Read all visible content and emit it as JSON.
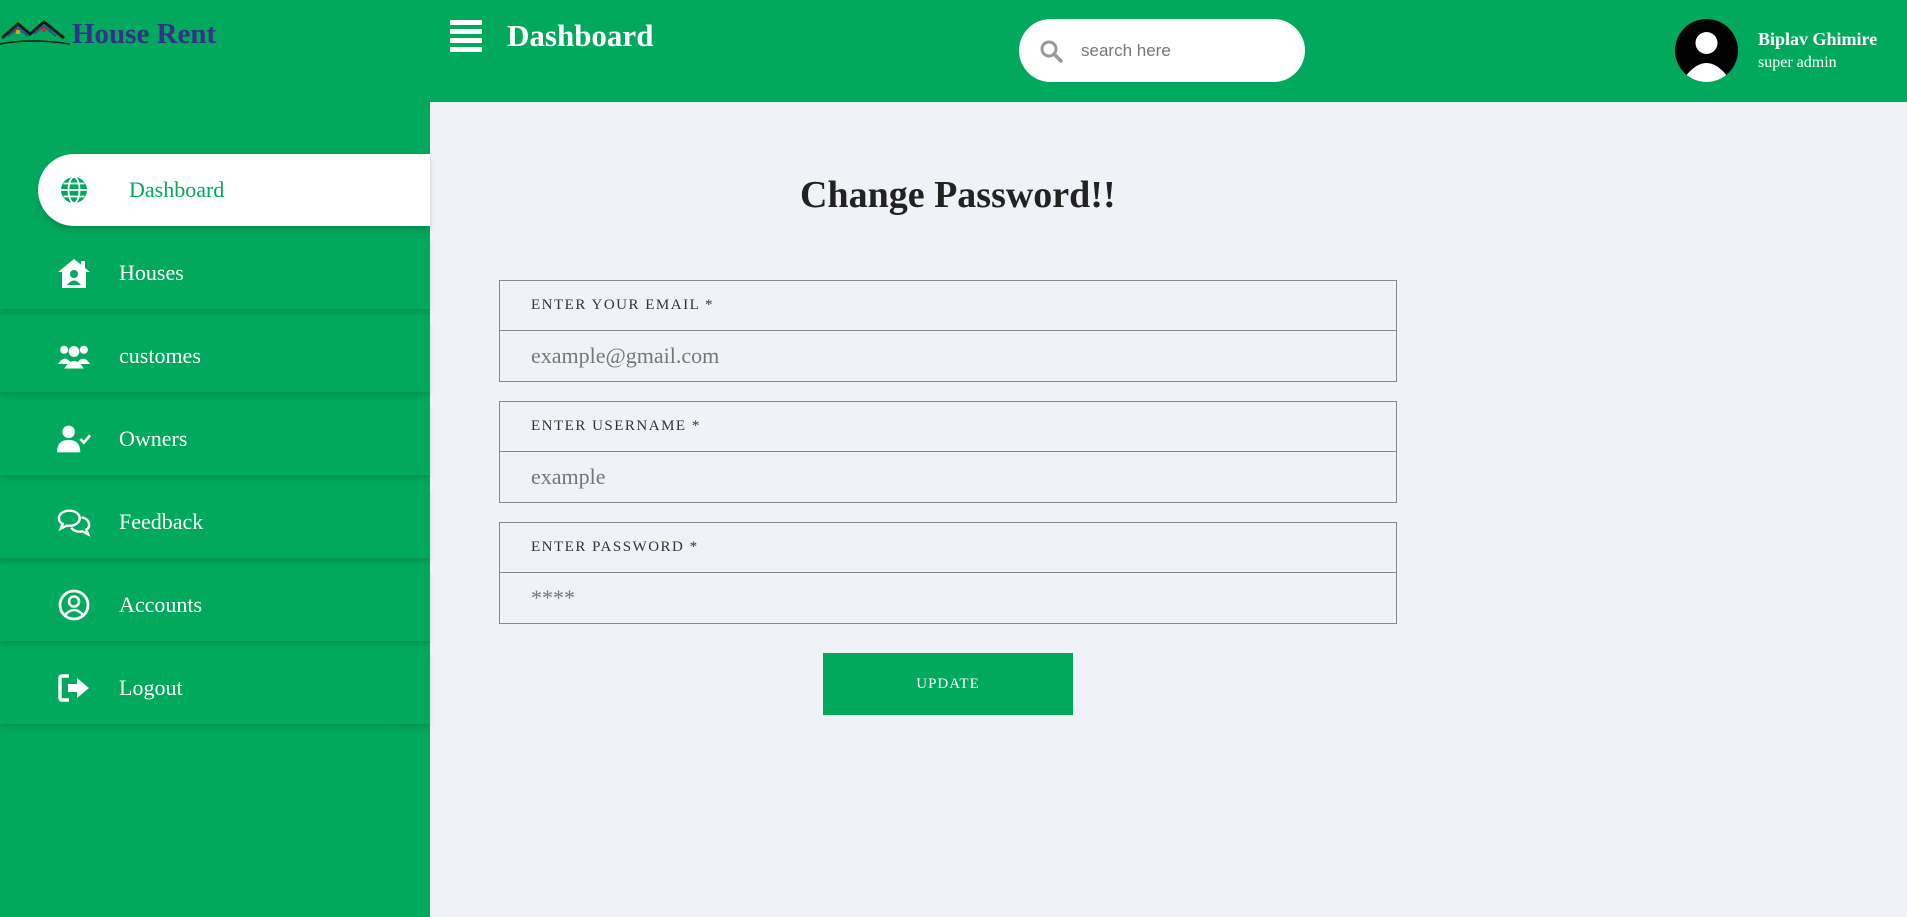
{
  "brand": {
    "name": "House Rent"
  },
  "topbar": {
    "title": "Dashboard",
    "search_placeholder": "search here",
    "user": {
      "name": "Biplav Ghimire",
      "role": "super admin"
    }
  },
  "sidebar": {
    "items": [
      {
        "label": "Dashboard",
        "icon": "globe-icon",
        "active": true
      },
      {
        "label": "Houses",
        "icon": "house-user-icon"
      },
      {
        "label": "customes",
        "icon": "users-icon"
      },
      {
        "label": "Owners",
        "icon": "user-check-icon"
      },
      {
        "label": "Feedback",
        "icon": "comments-icon"
      },
      {
        "label": "Accounts",
        "icon": "user-circle-icon"
      },
      {
        "label": "Logout",
        "icon": "sign-out-icon"
      }
    ]
  },
  "form": {
    "title": "Change Password!!",
    "email": {
      "label": "ENTER YOUR EMAIL *",
      "placeholder": "example@gmail.com"
    },
    "username": {
      "label": "ENTER USERNAME *",
      "placeholder": "example"
    },
    "password": {
      "label": "ENTER PASSWORD *",
      "placeholder": "****"
    },
    "submit_label": "UPDATE"
  },
  "colors": {
    "primary": "#00a95c",
    "brand_text": "#35308a",
    "background": "#eff2f7"
  }
}
